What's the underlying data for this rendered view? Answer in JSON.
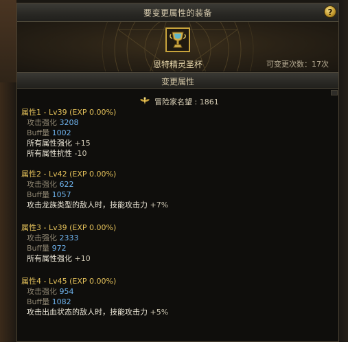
{
  "window": {
    "title": "要变更属性的装备",
    "help_label": "?"
  },
  "equip": {
    "item_name": "恩特精灵圣杯",
    "change_count": "可变更次数：17次",
    "item_icon": "chalice-icon"
  },
  "section": {
    "title": "变更属性"
  },
  "adventurer": {
    "label": "冒险家名望",
    "value": ": 1861",
    "icon": "fame-wings-icon"
  },
  "attributes": [
    {
      "header": "属性1 - Lv39 (EXP 0.00%)",
      "atk_label": "攻击强化",
      "atk_value": "3208",
      "buff_label": "Buff量",
      "buff_value": "1002",
      "effects": [
        {
          "text": "所有属性强化",
          "value": "+15"
        },
        {
          "text": "所有属性抗性",
          "value": "-10"
        }
      ]
    },
    {
      "header": "属性2 - Lv42 (EXP 0.00%)",
      "atk_label": "攻击强化",
      "atk_value": "622",
      "buff_label": "Buff量",
      "buff_value": "1057",
      "effects": [
        {
          "text": "攻击龙族类型的敌人时，技能攻击力",
          "value": "+7%"
        }
      ]
    },
    {
      "header": "属性3 - Lv39 (EXP 0.00%)",
      "atk_label": "攻击强化",
      "atk_value": "2333",
      "buff_label": "Buff量",
      "buff_value": "972",
      "effects": [
        {
          "text": "所有属性强化",
          "value": "+10"
        }
      ]
    },
    {
      "header": "属性4 - Lv45 (EXP 0.00%)",
      "atk_label": "攻击强化",
      "atk_value": "954",
      "buff_label": "Buff量",
      "buff_value": "1082",
      "effects": [
        {
          "text": "攻击出血状态的敌人时，技能攻击力",
          "value": "+5%"
        }
      ]
    }
  ]
}
